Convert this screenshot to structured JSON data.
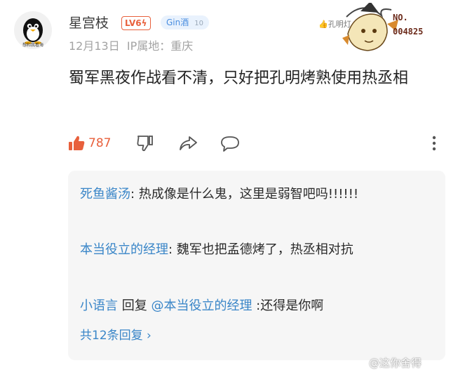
{
  "comment": {
    "username": "星宫枝",
    "level_badge": "LV6",
    "fan_badge": {
      "name": "Gin酒",
      "level": "10"
    },
    "date": "12月13日",
    "ip_label": "IP属地：重庆",
    "text": "蜀军黑夜作战看不清，只好把孔明烤熟使用热丞相",
    "like_count": "787",
    "avatar_caption": "想和我看海",
    "pendant": {
      "tag": "孔明灯",
      "number_label": "NO.",
      "number": "004825"
    }
  },
  "replies": [
    {
      "name": "死鱼酱汤",
      "text": ": 热成像是什么鬼，这里是弱智吧吗!!!!!!"
    },
    {
      "name": "本当役立的经理",
      "text": ": 魏军也把孟德烤了，热丞相对抗"
    },
    {
      "name": "小语言",
      "mid": " 回复 ",
      "target": "@本当役立的经理",
      "text": " :还得是你啊"
    }
  ],
  "more_replies": "共12条回复 ›",
  "watermark": "@这你舍得"
}
